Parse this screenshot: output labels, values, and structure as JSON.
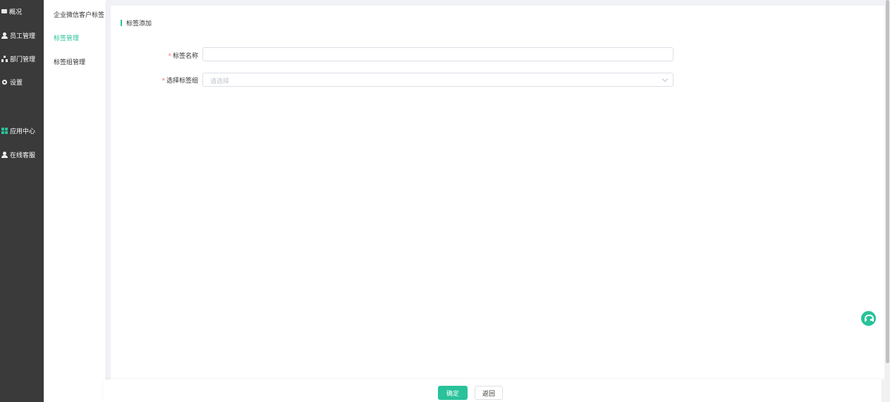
{
  "nav": {
    "items": [
      {
        "label": "概况",
        "icon": "overview-icon"
      },
      {
        "label": "员工管理",
        "icon": "user-icon"
      },
      {
        "label": "部门管理",
        "icon": "org-icon"
      },
      {
        "label": "设置",
        "icon": "gear-icon"
      },
      {
        "label": "应用中心",
        "icon": "grid-icon"
      },
      {
        "label": "在线客服",
        "icon": "support-user-icon"
      }
    ]
  },
  "submenu": {
    "title": "企业微信客户标签",
    "items": [
      {
        "label": "标签管理",
        "active": true
      },
      {
        "label": "标签组管理",
        "active": false
      }
    ]
  },
  "form": {
    "section_title": "标签添加",
    "fields": {
      "tag_name": {
        "label": "标签名称",
        "required_mark": "*",
        "value": ""
      },
      "tag_group": {
        "label": "选择标签组",
        "required_mark": "*",
        "placeholder": "请选择"
      }
    }
  },
  "footer": {
    "confirm_label": "确定",
    "back_label": "返回"
  },
  "colors": {
    "accent": "#29c29a",
    "nav_bg": "#3a3a3a",
    "required": "#f56c6c"
  }
}
